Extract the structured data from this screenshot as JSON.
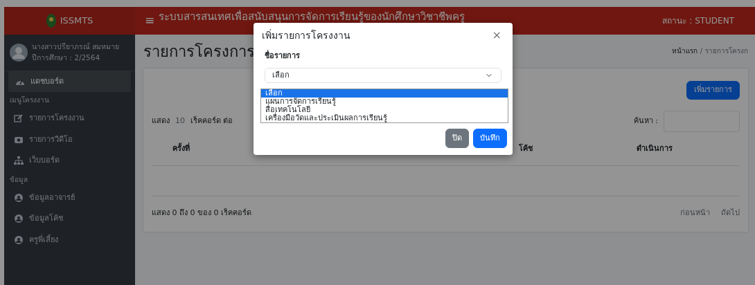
{
  "header": {
    "brand": "ISSMTS",
    "menu_glyph": "≡",
    "title": "ระบบสารสนเทศเพื่อสนับสนุนการจัดการเรียนรู้ของนักศึกษาวิชาชีพครู",
    "status": "สถานะ : STUDENT"
  },
  "sidebar": {
    "user": {
      "name": "นางสาวปรียาภรณ์ สมหมาย",
      "year": "ปีการศึกษา : 2/2564"
    },
    "items": [
      {
        "kind": "link",
        "label": "แดชบอร์ด",
        "selected": true
      },
      {
        "kind": "heading",
        "label": "เมนูโครงงาน"
      },
      {
        "kind": "link",
        "label": "รายการโครงงาน",
        "selected": false
      },
      {
        "kind": "link",
        "label": "รายการวีดีโอ",
        "selected": false
      },
      {
        "kind": "link",
        "label": "เว็บบอร์ด",
        "selected": false
      },
      {
        "kind": "heading",
        "label": "ข้อมูล"
      },
      {
        "kind": "link",
        "label": "ข้อมูลอาจารย์",
        "selected": false
      },
      {
        "kind": "link",
        "label": "ข้อมูลโค้ช",
        "selected": false
      },
      {
        "kind": "link",
        "label": "ครูพี่เลี้ยง",
        "selected": false
      }
    ]
  },
  "page": {
    "title": "รายการโครงการ",
    "breadcrumb": [
      "หน้าแรก",
      "รายการโครงก"
    ],
    "breadcrumb_separator": "/",
    "add_button": "เพิ่มรายการ"
  },
  "table": {
    "show_label": "แสดง",
    "page_size": "10",
    "per_page_label": "เร็คคอร์ด ต่อ",
    "search_label": "ค้นหา :",
    "columns": [
      "ครั้งที่",
      "โค้ช",
      "ดำเนินการ"
    ],
    "info": "แสดง 0 ถึง 0 ของ 0 เร็คคอร์ด",
    "prev": "ก่อนหน้า",
    "next": "ถัดไป"
  },
  "modal": {
    "title": "เพิ่มรายการโครงงาน",
    "close": "×",
    "field_label": "ชื่อรายการ",
    "value": "เลือก",
    "options": [
      {
        "label": "เลือก",
        "selected": true
      },
      {
        "label": "แผนการจัดการเรียนรู้",
        "selected": false
      },
      {
        "label": "สื่อเทคโนโลยี",
        "selected": false
      },
      {
        "label": "เครื่องมือวัดและประเมินผลการเรียนรู้",
        "selected": false
      }
    ],
    "buttons": [
      "ปิด",
      "บันทึก"
    ]
  }
}
